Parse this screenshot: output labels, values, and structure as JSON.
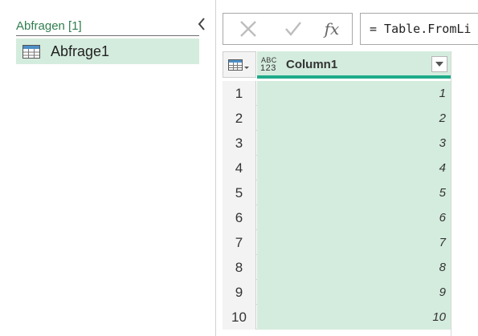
{
  "queries_pane": {
    "header": "Abfragen [1]",
    "items": [
      {
        "label": "Abfrage1",
        "icon": "table-icon"
      }
    ]
  },
  "formula_bar": {
    "formula": "= Table.FromLi",
    "fx_label": "fx"
  },
  "grid": {
    "column": {
      "name": "Column1",
      "type_label_top": "ABC",
      "type_label_bottom": "123"
    },
    "rows": [
      {
        "num": "1",
        "value": "1"
      },
      {
        "num": "2",
        "value": "2"
      },
      {
        "num": "3",
        "value": "3"
      },
      {
        "num": "4",
        "value": "4"
      },
      {
        "num": "5",
        "value": "5"
      },
      {
        "num": "6",
        "value": "6"
      },
      {
        "num": "7",
        "value": "7"
      },
      {
        "num": "8",
        "value": "8"
      },
      {
        "num": "9",
        "value": "9"
      },
      {
        "num": "10",
        "value": "10"
      }
    ]
  },
  "colors": {
    "accent_green": "#1fab8a",
    "selection_bg": "#d4ecde",
    "header_text_green": "#2f7d4f"
  }
}
